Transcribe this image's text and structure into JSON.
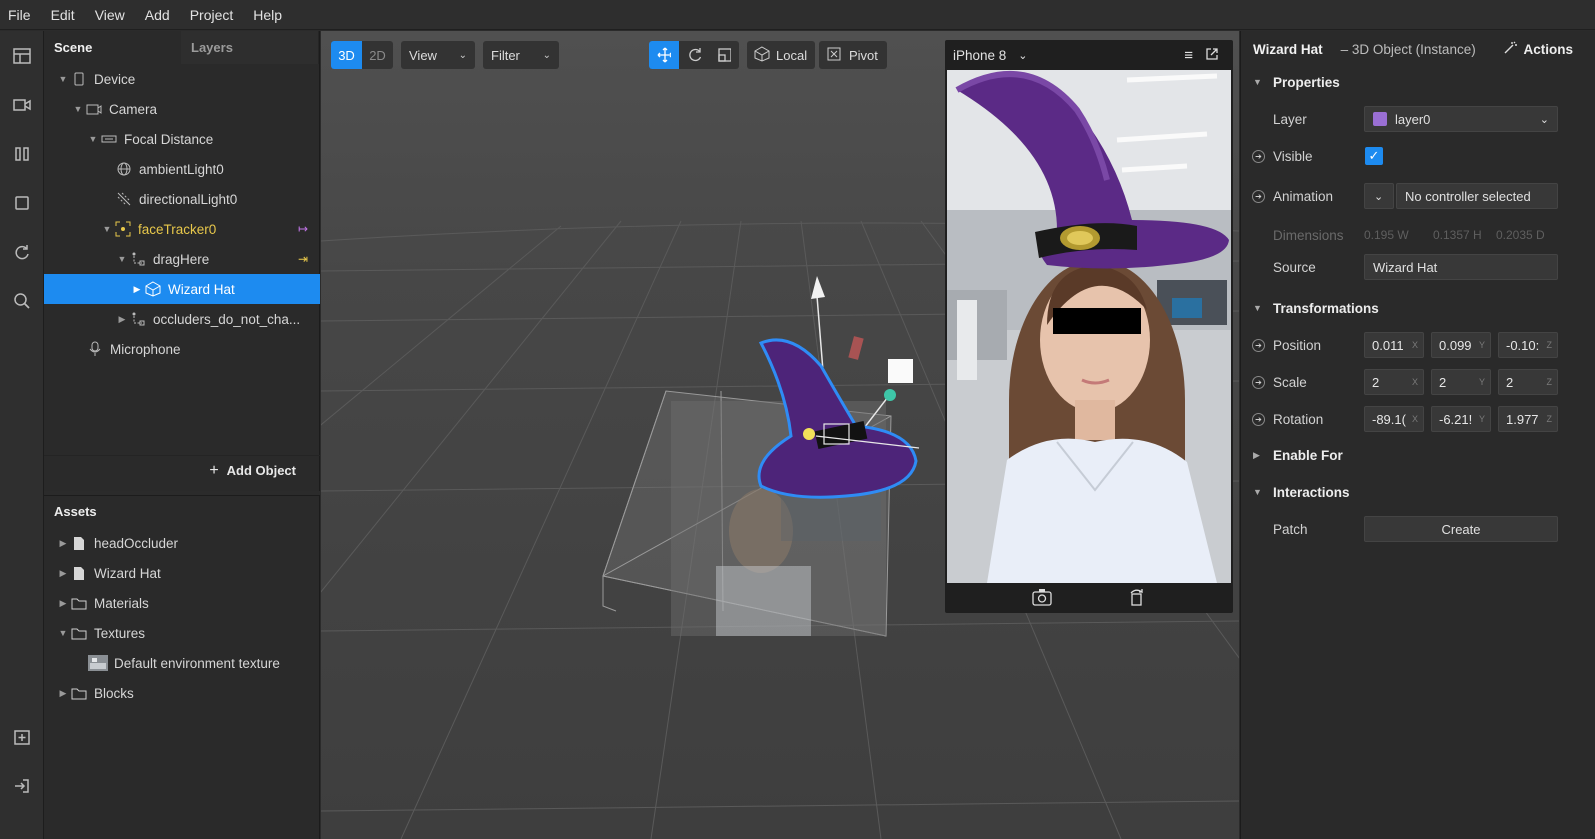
{
  "menu": [
    "File",
    "Edit",
    "View",
    "Add",
    "Project",
    "Help"
  ],
  "scene_panel": {
    "tab_scene": "Scene",
    "tab_layers": "Layers",
    "tree": [
      {
        "label": "Device",
        "depth": 0,
        "expanded": true,
        "icon": "device-icon"
      },
      {
        "label": "Camera",
        "depth": 1,
        "expanded": true,
        "icon": "camera-icon"
      },
      {
        "label": "Focal Distance",
        "depth": 2,
        "expanded": true,
        "icon": "focal-distance-icon"
      },
      {
        "label": "ambientLight0",
        "depth": 3,
        "expanded": null,
        "icon": "ambient-light-icon"
      },
      {
        "label": "directionalLight0",
        "depth": 3,
        "expanded": null,
        "icon": "directional-light-icon"
      },
      {
        "label": "faceTracker0",
        "depth": 3,
        "expanded": true,
        "icon": "face-tracker-icon",
        "highlight": "yellow"
      },
      {
        "label": "dragHere",
        "depth": 4,
        "expanded": true,
        "icon": "null-object-icon"
      },
      {
        "label": "Wizard Hat",
        "depth": 5,
        "expanded": false,
        "icon": "3d-object-icon",
        "selected": true
      },
      {
        "label": "occluders_do_not_cha...",
        "depth": 4,
        "expanded": false,
        "icon": "null-object-icon"
      },
      {
        "label": "Microphone",
        "depth": 1,
        "expanded": null,
        "icon": "microphone-icon"
      }
    ],
    "add_object": "Add Object"
  },
  "assets_panel": {
    "title": "Assets",
    "items": [
      {
        "label": "headOccluder",
        "depth": 0,
        "expanded": false,
        "icon": "file-icon"
      },
      {
        "label": "Wizard Hat",
        "depth": 0,
        "expanded": false,
        "icon": "file-icon"
      },
      {
        "label": "Materials",
        "depth": 0,
        "expanded": false,
        "icon": "folder-icon"
      },
      {
        "label": "Textures",
        "depth": 0,
        "expanded": true,
        "icon": "folder-icon"
      },
      {
        "label": "Default environment texture",
        "depth": 1,
        "expanded": null,
        "icon": "texture-thumbnail-icon"
      },
      {
        "label": "Blocks",
        "depth": 0,
        "expanded": false,
        "icon": "folder-icon"
      }
    ]
  },
  "viewport_toolbar": {
    "mode_3d": "3D",
    "mode_2d": "2D",
    "view": "View",
    "filter": "Filter",
    "local": "Local",
    "pivot": "Pivot"
  },
  "simulator": {
    "device": "iPhone 8"
  },
  "inspector": {
    "object_name": "Wizard Hat",
    "object_type": "– 3D Object (Instance)",
    "actions": "Actions",
    "properties_title": "Properties",
    "layer_label": "Layer",
    "layer_value": "layer0",
    "layer_color": "#9a6fd4",
    "visible_label": "Visible",
    "visible_checked": true,
    "animation_label": "Animation",
    "animation_value": "No controller selected",
    "dimensions_label": "Dimensions",
    "dim_w": "0.195 W",
    "dim_h": "0.1357 H",
    "dim_d": "0.2035 D",
    "source_label": "Source",
    "source_value": "Wizard Hat",
    "transformations_title": "Transformations",
    "position_label": "Position",
    "position": [
      "0.011",
      "0.099",
      "-0.10:"
    ],
    "scale_label": "Scale",
    "scale": [
      "2",
      "2",
      "2"
    ],
    "rotation_label": "Rotation",
    "rotation": [
      "-89.1(",
      "-6.21!",
      "1.977"
    ],
    "enable_for_title": "Enable For",
    "interactions_title": "Interactions",
    "patch_label": "Patch",
    "create_button": "Create"
  },
  "colors": {
    "accent": "#1d8bf0",
    "hat_purple": "#5b2a86",
    "highlight_yellow": "#e8c84b"
  }
}
